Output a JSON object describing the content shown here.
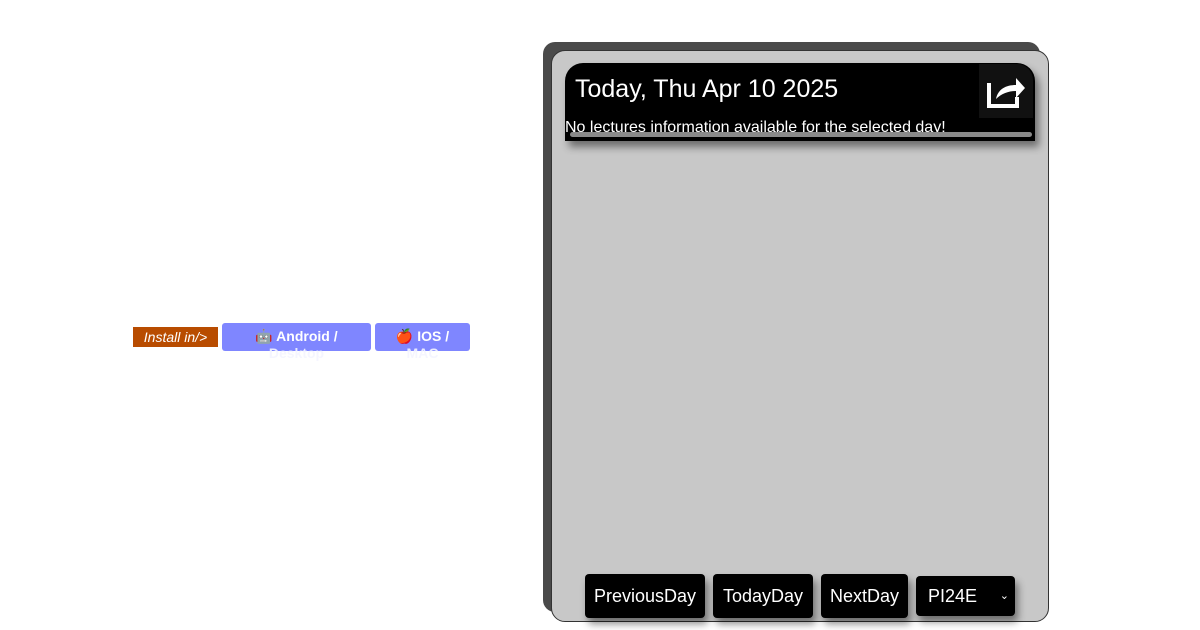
{
  "install": {
    "label": "Install in/>",
    "android_label": "🤖 Android /",
    "android_sub": "Desktop",
    "ios_label": "🍎 IOS /",
    "ios_sub": "MAC"
  },
  "schedule": {
    "title": "Today, Thu Apr 10 2025",
    "message": "No lectures information available for the selected day!",
    "share_icon": "share-icon"
  },
  "nav": {
    "previous": "PreviousDay",
    "today": "TodayDay",
    "next": "NextDay",
    "group_selected": "PI24E"
  }
}
